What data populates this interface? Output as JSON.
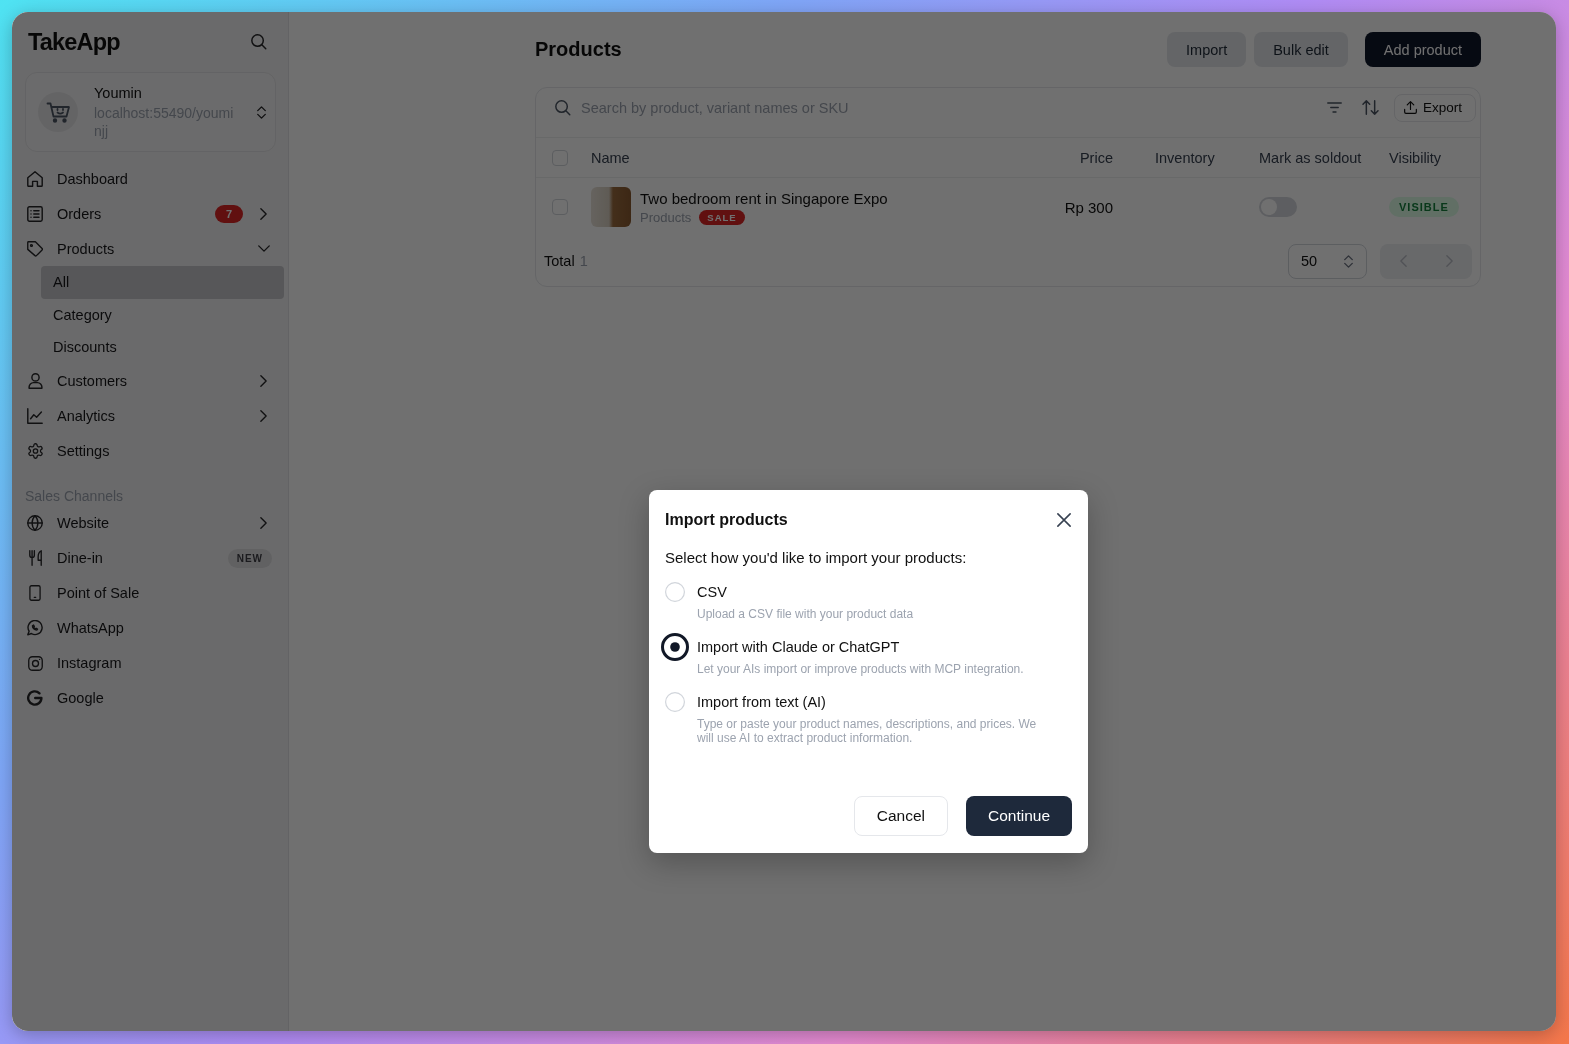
{
  "sidebar": {
    "logo": "TakeApp",
    "store": {
      "name": "Youmin",
      "url": "localhost:55490/youminjj"
    },
    "nav": [
      {
        "label": "Dashboard",
        "kind": "link",
        "selected": false
      },
      {
        "label": "Orders",
        "kind": "group",
        "selected": false,
        "expanded": false,
        "badge": "7"
      },
      {
        "label": "Products",
        "kind": "group",
        "selected": false,
        "expanded": true,
        "children": [
          {
            "label": "All",
            "selected": true
          },
          {
            "label": "Category",
            "selected": false
          },
          {
            "label": "Discounts",
            "selected": false
          }
        ]
      },
      {
        "label": "Customers",
        "kind": "group",
        "selected": false,
        "expanded": false
      },
      {
        "label": "Analytics",
        "kind": "group",
        "selected": false,
        "expanded": false
      },
      {
        "label": "Settings",
        "kind": "link",
        "selected": false
      }
    ],
    "sales_channels": {
      "heading": "Sales Channels",
      "items": [
        {
          "label": "Website",
          "kind": "group",
          "selected": false,
          "expanded": false
        },
        {
          "label": "Dine-in",
          "kind": "link",
          "selected": false,
          "tag": "NEW"
        },
        {
          "label": "Point of Sale",
          "kind": "link",
          "selected": false
        },
        {
          "label": "WhatsApp",
          "kind": "link",
          "selected": false
        },
        {
          "label": "Instagram",
          "kind": "link",
          "selected": false
        },
        {
          "label": "Google",
          "kind": "link",
          "selected": false
        }
      ]
    }
  },
  "page": {
    "title": "Products",
    "actions": [
      {
        "label": "Import",
        "kind": "secondary"
      },
      {
        "label": "Bulk edit",
        "kind": "secondary"
      },
      {
        "label": "Add product",
        "kind": "primary"
      }
    ]
  },
  "table": {
    "search": {
      "placeholder": "Search by product, variant names or SKU"
    },
    "export": "Export",
    "header_checked": false,
    "columns": [
      "Name",
      "Price",
      "Inventory",
      "Mark as soldout",
      "Visibility"
    ],
    "rows": [
      {
        "checked": false,
        "name": "Two bedroom rent in Singapore Expo",
        "category": "Products",
        "tag": "SALE",
        "price": "Rp 300",
        "soldout": false,
        "visibility": "VISIBLE"
      }
    ],
    "total_label": "Total",
    "total": "1",
    "page_size": "50",
    "pagination": {
      "previous_disabled": true,
      "next_disabled": true
    }
  },
  "modal": {
    "title": "Import products",
    "prompt": "Select how you'd like to import your products:",
    "options": [
      {
        "label": "CSV",
        "description": "Upload a CSV file with your product data",
        "selected": false
      },
      {
        "label": "Import with Claude or ChatGPT",
        "description": "Let your AIs import or improve products with MCP integration.",
        "selected": true
      },
      {
        "label": "Import from text (AI)",
        "description": "Type or paste your product names, descriptions, and prices. We will use AI to extract product information.",
        "selected": false
      }
    ],
    "buttons": [
      {
        "label": "Cancel",
        "kind": "secondary"
      },
      {
        "label": "Continue",
        "kind": "primary"
      }
    ]
  }
}
